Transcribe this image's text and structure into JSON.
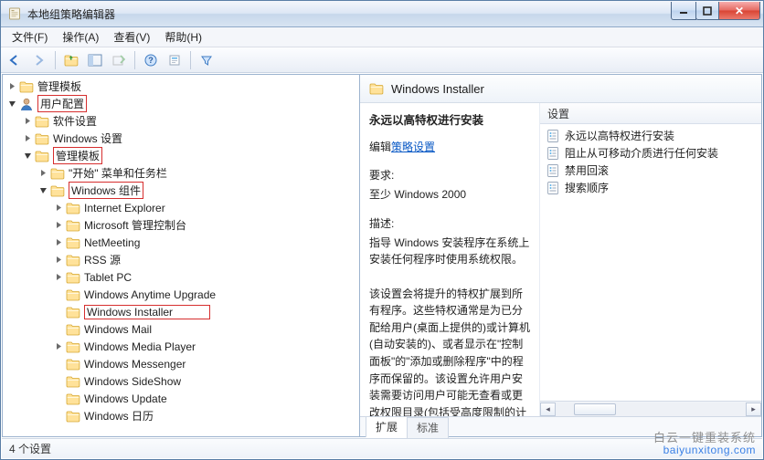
{
  "title": "本地组策略编辑器",
  "menus": {
    "file": "文件(F)",
    "action": "操作(A)",
    "view": "查看(V)",
    "help": "帮助(H)"
  },
  "tree": {
    "admin_templates_top": "管理模板",
    "user_config": "用户配置",
    "software_settings": "软件设置",
    "windows_settings": "Windows 设置",
    "admin_templates": "管理模板",
    "start_taskbar": "\"开始\" 菜单和任务栏",
    "windows_components": "Windows 组件",
    "items": {
      "ie": "Internet Explorer",
      "mmc": "Microsoft 管理控制台",
      "netmeeting": "NetMeeting",
      "rss": "RSS 源",
      "tablet": "Tablet PC",
      "anytime": "Windows Anytime Upgrade",
      "installer": "Windows Installer",
      "mail": "Windows Mail",
      "wmp": "Windows Media Player",
      "messenger": "Windows Messenger",
      "sideshow": "Windows SideShow",
      "update": "Windows Update",
      "calendar": "Windows 日历"
    }
  },
  "header": "Windows Installer",
  "desc": {
    "policy_title": "永远以高特权进行安装",
    "edit_prefix": "编辑",
    "edit_link": "策略设置",
    "req_label": "要求:",
    "req_value": "至少 Windows 2000",
    "desc_label": "描述:",
    "desc_body1": "指导 Windows 安装程序在系统上安装任何程序时使用系统权限。",
    "desc_body2": "该设置会将提升的特权扩展到所有程序。这些特权通常是为已分配给用户(桌面上提供的)或计算机(自动安装的)、或者显示在\"控制面板\"的\"添加或删除程序\"中的程序而保留的。该设置允许用户安装需要访问用户可能无查看或更改权限目录(包括受高度限制的计算机上的目"
  },
  "list": {
    "col_header": "设置",
    "rows": {
      "r1": "永远以高特权进行安装",
      "r2": "阻止从可移动介质进行任何安装",
      "r3": "禁用回滚",
      "r4": "搜索顺序"
    }
  },
  "tabs": {
    "extended": "扩展",
    "standard": "标准"
  },
  "status": "4 个设置",
  "watermark": {
    "cn": "白云一键重装系统",
    "en": "baiyunxitong.com"
  }
}
